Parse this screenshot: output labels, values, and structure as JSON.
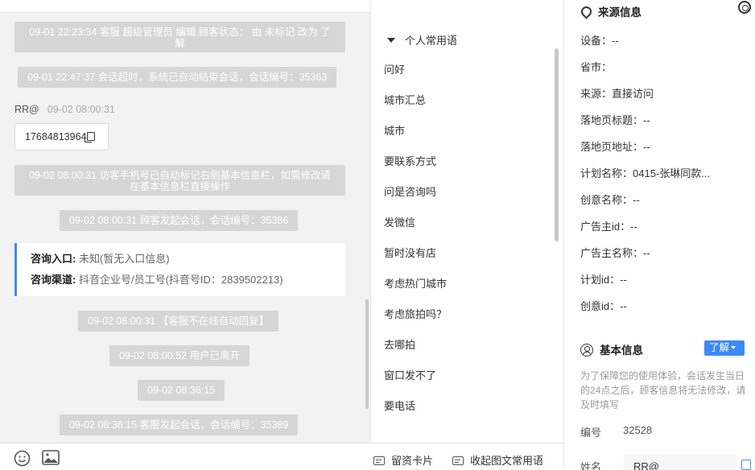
{
  "chat": {
    "messages": [
      {
        "line1": "09-01 22:23:34 客服 超级管理员 编辑 顾客状态： 由 未标记 改为 了",
        "line2": "解"
      },
      {
        "text": "09-01 22:47:37 会话超时，系统已自动结束会话，会话编号：35363"
      },
      {
        "sender": "RR@",
        "time": "09-02 08:00:31",
        "phone": "17684813964"
      },
      {
        "line1": "09-02 08:00:31 访客手机号已自动标记右侧基本信息栏，如需修改请",
        "line2": "在基本信息栏直接操作"
      },
      {
        "text": "09-02 08:00:31 顾客发起会话，会话编号：35386"
      },
      {
        "text": "09-02 08:00:31 【客服不在线自动回复】"
      },
      {
        "text": "09-02 08:00:52 用户已离开"
      },
      {
        "text": "09-02 08:36:15"
      },
      {
        "text": "09-02 08:36:15 客服发起会话，会话编号：35389"
      }
    ],
    "entry_card": {
      "entry_label": "咨询入口:",
      "entry_value": "未知(暂无入口信息)",
      "channel_label": "咨询渠道:",
      "channel_value": "抖音企业号/员工号(抖音号ID：2839502213)"
    }
  },
  "toolbar": {
    "emoji_icon": "smile-icon",
    "image_icon": "image-icon",
    "card_label": "留资卡片",
    "collect_label": "收起图文常用语"
  },
  "phrases": {
    "group_title": "个人常用语",
    "items": [
      "问好",
      "城市汇总",
      "城市",
      "要联系方式",
      "问是咨询吗",
      "发微信",
      "暂时没有店",
      "考虑热门城市",
      "考虑旅拍吗？",
      "去哪拍",
      "窗口发不了",
      "要电话"
    ]
  },
  "info": {
    "source_title": "来源信息",
    "source_fields": [
      "设备：--",
      "省市：",
      "来源：直接访问",
      "落地页标题：--",
      "落地页地址：--",
      "计划名称：0415-张琳同款...",
      "创意名称：--",
      "广告主id：--",
      "广告主名称：--",
      "计划id：--",
      "创意id：--"
    ],
    "basic_title": "基本信息",
    "learn_label": "了解",
    "notice": "为了保障您的使用体验，会话发生当日的24点之后，顾客信息将无法修改，请及时填写",
    "id_label": "编号",
    "id_value": "32528",
    "name_label": "姓名",
    "name_value": "RR@"
  }
}
